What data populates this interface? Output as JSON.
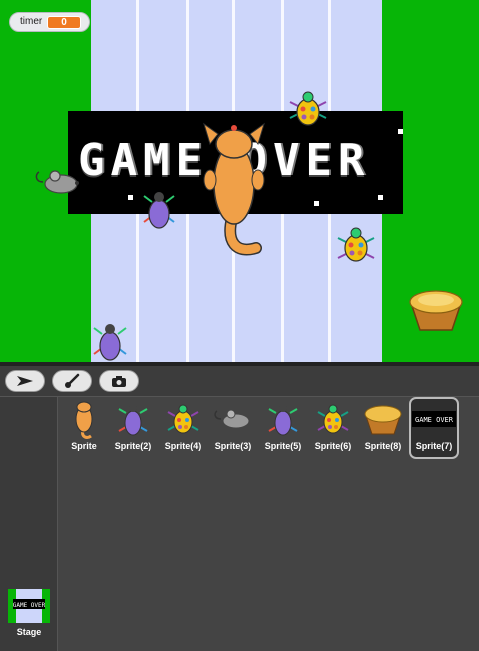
{
  "stage": {
    "timer": {
      "label": "timer",
      "value": "0"
    },
    "gameover_text": "GAME OVER"
  },
  "toolbar": {
    "tools": [
      {
        "name": "arrow",
        "icon": "cursor-arrow-icon"
      },
      {
        "name": "brush",
        "icon": "paintbrush-icon"
      },
      {
        "name": "camera",
        "icon": "camera-icon"
      }
    ]
  },
  "sprites": [
    {
      "label": "Sprite",
      "icon": "cat-sprite-icon"
    },
    {
      "label": "Sprite(2)",
      "icon": "purple-beetle-icon"
    },
    {
      "label": "Sprite(4)",
      "icon": "spotted-beetle-icon"
    },
    {
      "label": "Sprite(3)",
      "icon": "mouse-icon"
    },
    {
      "label": "Sprite(5)",
      "icon": "purple-beetle-icon"
    },
    {
      "label": "Sprite(6)",
      "icon": "spotted-beetle-icon"
    },
    {
      "label": "Sprite(8)",
      "icon": "pie-bowl-icon"
    },
    {
      "label": "Sprite(7)",
      "icon": "gameover-thumbnail-icon",
      "selected": true
    }
  ],
  "stage_tile": {
    "label": "Stage",
    "thumb_text": "GAME OVER"
  },
  "colors": {
    "grass": "#07b507",
    "road": "#cdd6fa",
    "accent": "#f07a21",
    "panel": "#444444"
  }
}
